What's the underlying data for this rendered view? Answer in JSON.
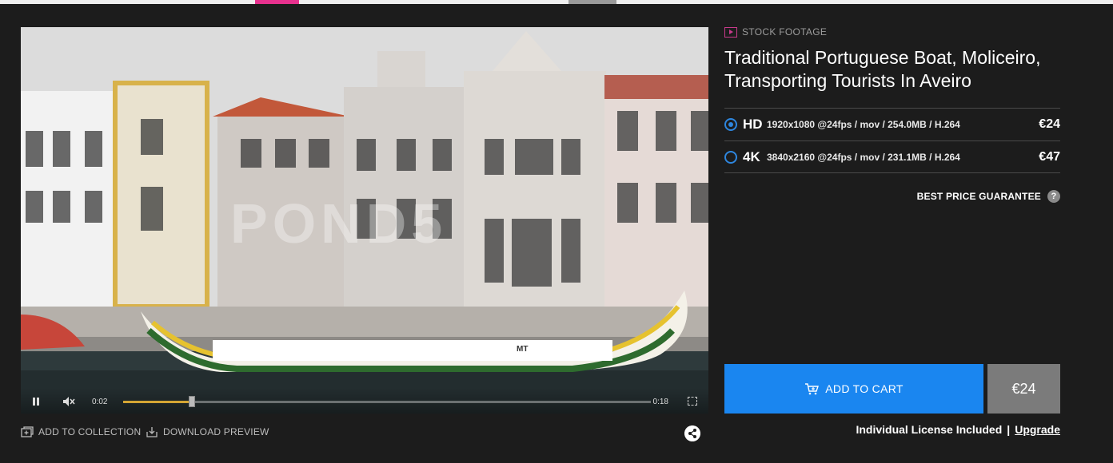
{
  "colors": {
    "accent_blue": "#1a86f0",
    "brand_pink": "#e8318e",
    "background": "#1c1c1c"
  },
  "category": {
    "label": "STOCK FOOTAGE",
    "icon": "play-box-icon"
  },
  "title": "Traditional Portuguese Boat, Moliceiro, Transporting Tourists In Aveiro",
  "player": {
    "watermark": "POND5",
    "boat_text": "MT",
    "time_current": "0:02",
    "time_total": "0:18",
    "progress": 0.13
  },
  "options": [
    {
      "quality": "HD",
      "spec": "1920x1080 @24fps / mov / 254.0MB / H.264",
      "price": "€24",
      "selected": true
    },
    {
      "quality": "4K",
      "spec": "3840x2160 @24fps / mov / 231.1MB / H.264",
      "price": "€47",
      "selected": false
    }
  ],
  "guarantee": {
    "label": "BEST PRICE GUARANTEE",
    "icon_text": "?"
  },
  "cart": {
    "label": "ADD TO CART",
    "price": "€24"
  },
  "license": {
    "text": "Individual License Included",
    "separator": "|",
    "upgrade": "Upgrade"
  },
  "actions": {
    "add_collection": "ADD TO COLLECTION",
    "download_preview": "DOWNLOAD PREVIEW"
  }
}
